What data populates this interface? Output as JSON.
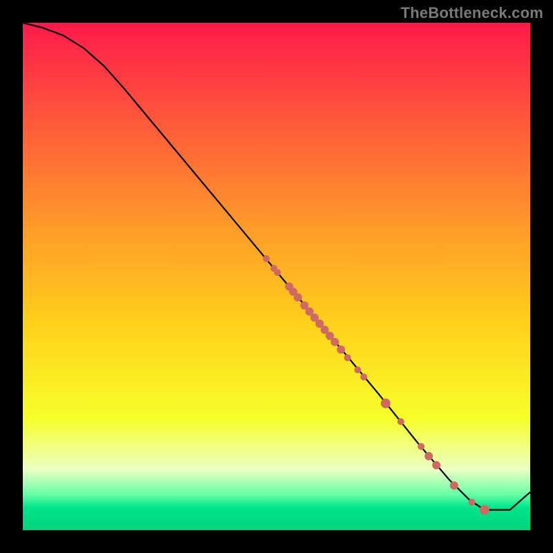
{
  "watermark": "TheBottleneck.com",
  "chart_data": {
    "type": "line",
    "title": "",
    "xlabel": "",
    "ylabel": "",
    "xlim": [
      0,
      100
    ],
    "ylim": [
      0,
      100
    ],
    "grid": false,
    "legend": false,
    "background_gradient": {
      "stops": [
        {
          "offset": 0.0,
          "color": "#ff1a4b"
        },
        {
          "offset": 0.2,
          "color": "#ff5a3a"
        },
        {
          "offset": 0.4,
          "color": "#ff9a2a"
        },
        {
          "offset": 0.6,
          "color": "#ffd21a"
        },
        {
          "offset": 0.78,
          "color": "#f6ff2a"
        },
        {
          "offset": 0.88,
          "color": "#ecffc4"
        },
        {
          "offset": 0.93,
          "color": "#66ffa6"
        },
        {
          "offset": 0.955,
          "color": "#00e48a"
        },
        {
          "offset": 1.0,
          "color": "#00d47a"
        }
      ]
    },
    "series": [
      {
        "name": "curve",
        "color": "#000000",
        "x": [
          0,
          4,
          8,
          12,
          16,
          20,
          30,
          40,
          50,
          60,
          70,
          78,
          84,
          88,
          91,
          92.5,
          96,
          100
        ],
        "y": [
          100,
          99,
          97.5,
          95,
          91.5,
          87,
          75,
          63,
          51,
          39,
          27,
          17,
          10,
          6,
          4,
          4,
          4,
          7.5
        ]
      }
    ],
    "scatter": {
      "name": "highlight-points",
      "color": "#cf6a63",
      "points": [
        {
          "x": 48.0,
          "y": 53.5,
          "r": 5
        },
        {
          "x": 49.5,
          "y": 51.6,
          "r": 5
        },
        {
          "x": 50.2,
          "y": 50.8,
          "r": 5
        },
        {
          "x": 52.5,
          "y": 48.0,
          "r": 6
        },
        {
          "x": 53.3,
          "y": 47.0,
          "r": 6
        },
        {
          "x": 54.2,
          "y": 45.9,
          "r": 6
        },
        {
          "x": 55.5,
          "y": 44.3,
          "r": 6
        },
        {
          "x": 56.5,
          "y": 43.1,
          "r": 6
        },
        {
          "x": 57.5,
          "y": 41.9,
          "r": 6
        },
        {
          "x": 58.5,
          "y": 40.7,
          "r": 6
        },
        {
          "x": 59.5,
          "y": 39.5,
          "r": 6
        },
        {
          "x": 60.5,
          "y": 38.3,
          "r": 6
        },
        {
          "x": 61.5,
          "y": 37.1,
          "r": 6
        },
        {
          "x": 62.7,
          "y": 35.6,
          "r": 6
        },
        {
          "x": 64.0,
          "y": 34.0,
          "r": 5
        },
        {
          "x": 66.0,
          "y": 31.6,
          "r": 5
        },
        {
          "x": 67.2,
          "y": 30.2,
          "r": 5
        },
        {
          "x": 71.5,
          "y": 25.0,
          "r": 7
        },
        {
          "x": 74.5,
          "y": 21.4,
          "r": 5
        },
        {
          "x": 78.5,
          "y": 16.5,
          "r": 5
        },
        {
          "x": 80.0,
          "y": 14.6,
          "r": 6
        },
        {
          "x": 81.5,
          "y": 12.8,
          "r": 6
        },
        {
          "x": 85.0,
          "y": 8.8,
          "r": 6
        },
        {
          "x": 88.5,
          "y": 5.5,
          "r": 5
        },
        {
          "x": 91.0,
          "y": 4.0,
          "r": 7
        }
      ]
    }
  }
}
